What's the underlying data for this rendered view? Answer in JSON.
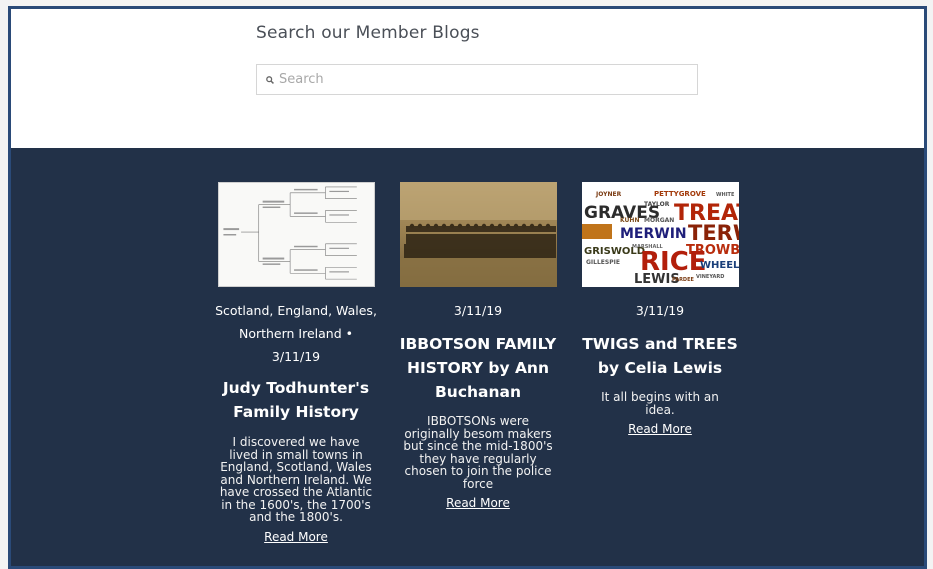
{
  "search": {
    "heading": "Search our Member Blogs",
    "placeholder": "Search"
  },
  "posts": [
    {
      "meta": "Scotland, England, Wales, Northern Ireland • 3/11/19",
      "title": "Judy Todhunter's Family History",
      "excerpt": "I discovered we have lived in small towns in England, Scotland, Wales and Northern Ireland. We have crossed the Atlantic in the 1600's, the 1700's and the 1800's.",
      "read_more": "Read More"
    },
    {
      "meta": "3/11/19",
      "title": "IBBOTSON FAMILY HISTORY by Ann Buchanan",
      "excerpt": "IBBOTSONs were originally besom makers but since the mid-1800's they have regularly chosen to join the police force",
      "read_more": "Read More"
    },
    {
      "meta": "3/11/19",
      "title": "TWIGS and TREES by Celia Lewis",
      "excerpt": "It all begins with an idea.",
      "read_more": "Read More"
    }
  ],
  "word_cloud": [
    "JOYNER",
    "PETTYGROVE",
    "WHITE",
    "GRAVES",
    "TREAT",
    "TAYLOR",
    "KUHN",
    "MORGAN",
    "TERWIL",
    "MERWIN",
    "MARSHALL",
    "GRISWOLD",
    "TROWBRI",
    "RICE",
    "GILLESPIE",
    "WHEELE",
    "LEWIS",
    "PARDEE",
    "VINEYARD"
  ],
  "colors": {
    "band": "#223148",
    "frame_border": "#2a4a78",
    "heading": "#4a4f57"
  }
}
